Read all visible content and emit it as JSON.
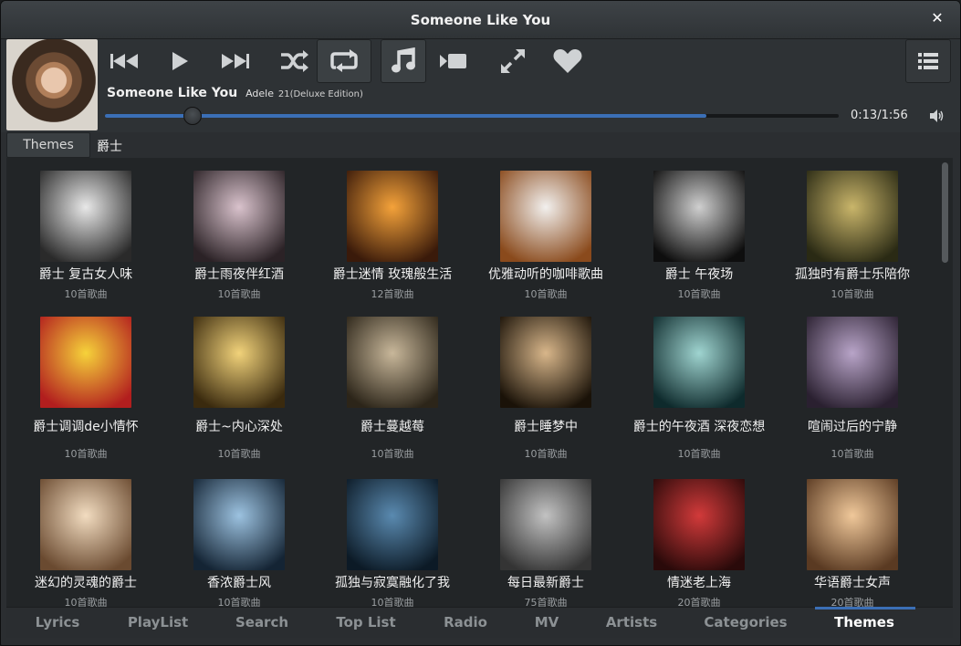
{
  "window": {
    "title": "Someone Like You"
  },
  "player": {
    "song": "Someone Like You",
    "artist": "Adele",
    "album": "21(Deluxe Edition)",
    "time": "0:13/1:56",
    "progress_fraction": 0.12,
    "buffered_fraction": 0.82
  },
  "breadcrumb": {
    "back_label": "Themes",
    "current": "爵士"
  },
  "playlists": [
    {
      "name": "爵士 复古女人味",
      "count": "10首歌曲",
      "colors": [
        "#e8e8e8",
        "#2a2a2a"
      ]
    },
    {
      "name": "爵士雨夜伴红酒",
      "count": "10首歌曲",
      "colors": [
        "#d9c2cc",
        "#2b2226"
      ]
    },
    {
      "name": "爵士迷情 玫瑰般生活",
      "count": "12首歌曲",
      "colors": [
        "#f4a23a",
        "#3a1a0a"
      ]
    },
    {
      "name": "优雅动听的咖啡歌曲",
      "count": "10首歌曲",
      "colors": [
        "#f2f0ee",
        "#8a4a1c"
      ]
    },
    {
      "name": "爵士 午夜场",
      "count": "10首歌曲",
      "colors": [
        "#cfcfcf",
        "#0e0e0e"
      ]
    },
    {
      "name": "孤独时有爵士乐陪你",
      "count": "10首歌曲",
      "colors": [
        "#c9b56a",
        "#2a2a14"
      ]
    },
    {
      "name": "爵士调调de小情怀",
      "count": "10首歌曲",
      "colors": [
        "#f6d23a",
        "#b21e1e"
      ]
    },
    {
      "name": "爵士~内心深处",
      "count": "10首歌曲",
      "colors": [
        "#f1d27a",
        "#3a2a0e"
      ]
    },
    {
      "name": "爵士蔓越莓",
      "count": "10首歌曲",
      "colors": [
        "#c8b79a",
        "#2c2519"
      ]
    },
    {
      "name": "爵士睡梦中",
      "count": "10首歌曲",
      "colors": [
        "#d8b68a",
        "#1a1208"
      ]
    },
    {
      "name": "爵士的午夜酒 深夜恋想",
      "count": "10首歌曲",
      "colors": [
        "#9fd4d0",
        "#0e2a2c"
      ]
    },
    {
      "name": "喧闹过后的宁静",
      "count": "10首歌曲",
      "colors": [
        "#b8a4c8",
        "#2a2030"
      ]
    },
    {
      "name": "迷幻的灵魂的爵士",
      "count": "10首歌曲",
      "colors": [
        "#f2dcc0",
        "#6a4a30"
      ]
    },
    {
      "name": "香浓爵士风",
      "count": "10首歌曲",
      "colors": [
        "#9cc2e0",
        "#142434"
      ]
    },
    {
      "name": "孤独与寂寞融化了我",
      "count": "10首歌曲",
      "colors": [
        "#5a8ab0",
        "#0c1a26"
      ]
    },
    {
      "name": "每日最新爵士",
      "count": "75首歌曲",
      "colors": [
        "#c2c2c2",
        "#343434"
      ]
    },
    {
      "name": "情迷老上海",
      "count": "20首歌曲",
      "colors": [
        "#d23a3a",
        "#2a0a0a"
      ]
    },
    {
      "name": "华语爵士女声",
      "count": "20首歌曲",
      "colors": [
        "#f0c89a",
        "#5a3a22"
      ]
    }
  ],
  "tabs": [
    {
      "label": "Lyrics",
      "active": false
    },
    {
      "label": "PlayList",
      "active": false
    },
    {
      "label": "Search",
      "active": false
    },
    {
      "label": "Top List",
      "active": false
    },
    {
      "label": "Radio",
      "active": false
    },
    {
      "label": "MV",
      "active": false
    },
    {
      "label": "Artists",
      "active": false
    },
    {
      "label": "Categories",
      "active": false
    },
    {
      "label": "Themes",
      "active": true
    }
  ],
  "icons": {
    "previous": "previous-icon",
    "play": "play-icon",
    "next": "next-icon",
    "shuffle": "shuffle-icon",
    "repeat": "repeat-icon",
    "music": "music-note-icon",
    "video": "video-icon",
    "fullscreen": "fullscreen-icon",
    "favorite": "heart-icon",
    "menu": "list-menu-icon",
    "volume": "volume-icon",
    "close": "close-icon"
  },
  "colors": {
    "accent": "#3b6fb6",
    "background": "#2b2e31"
  }
}
